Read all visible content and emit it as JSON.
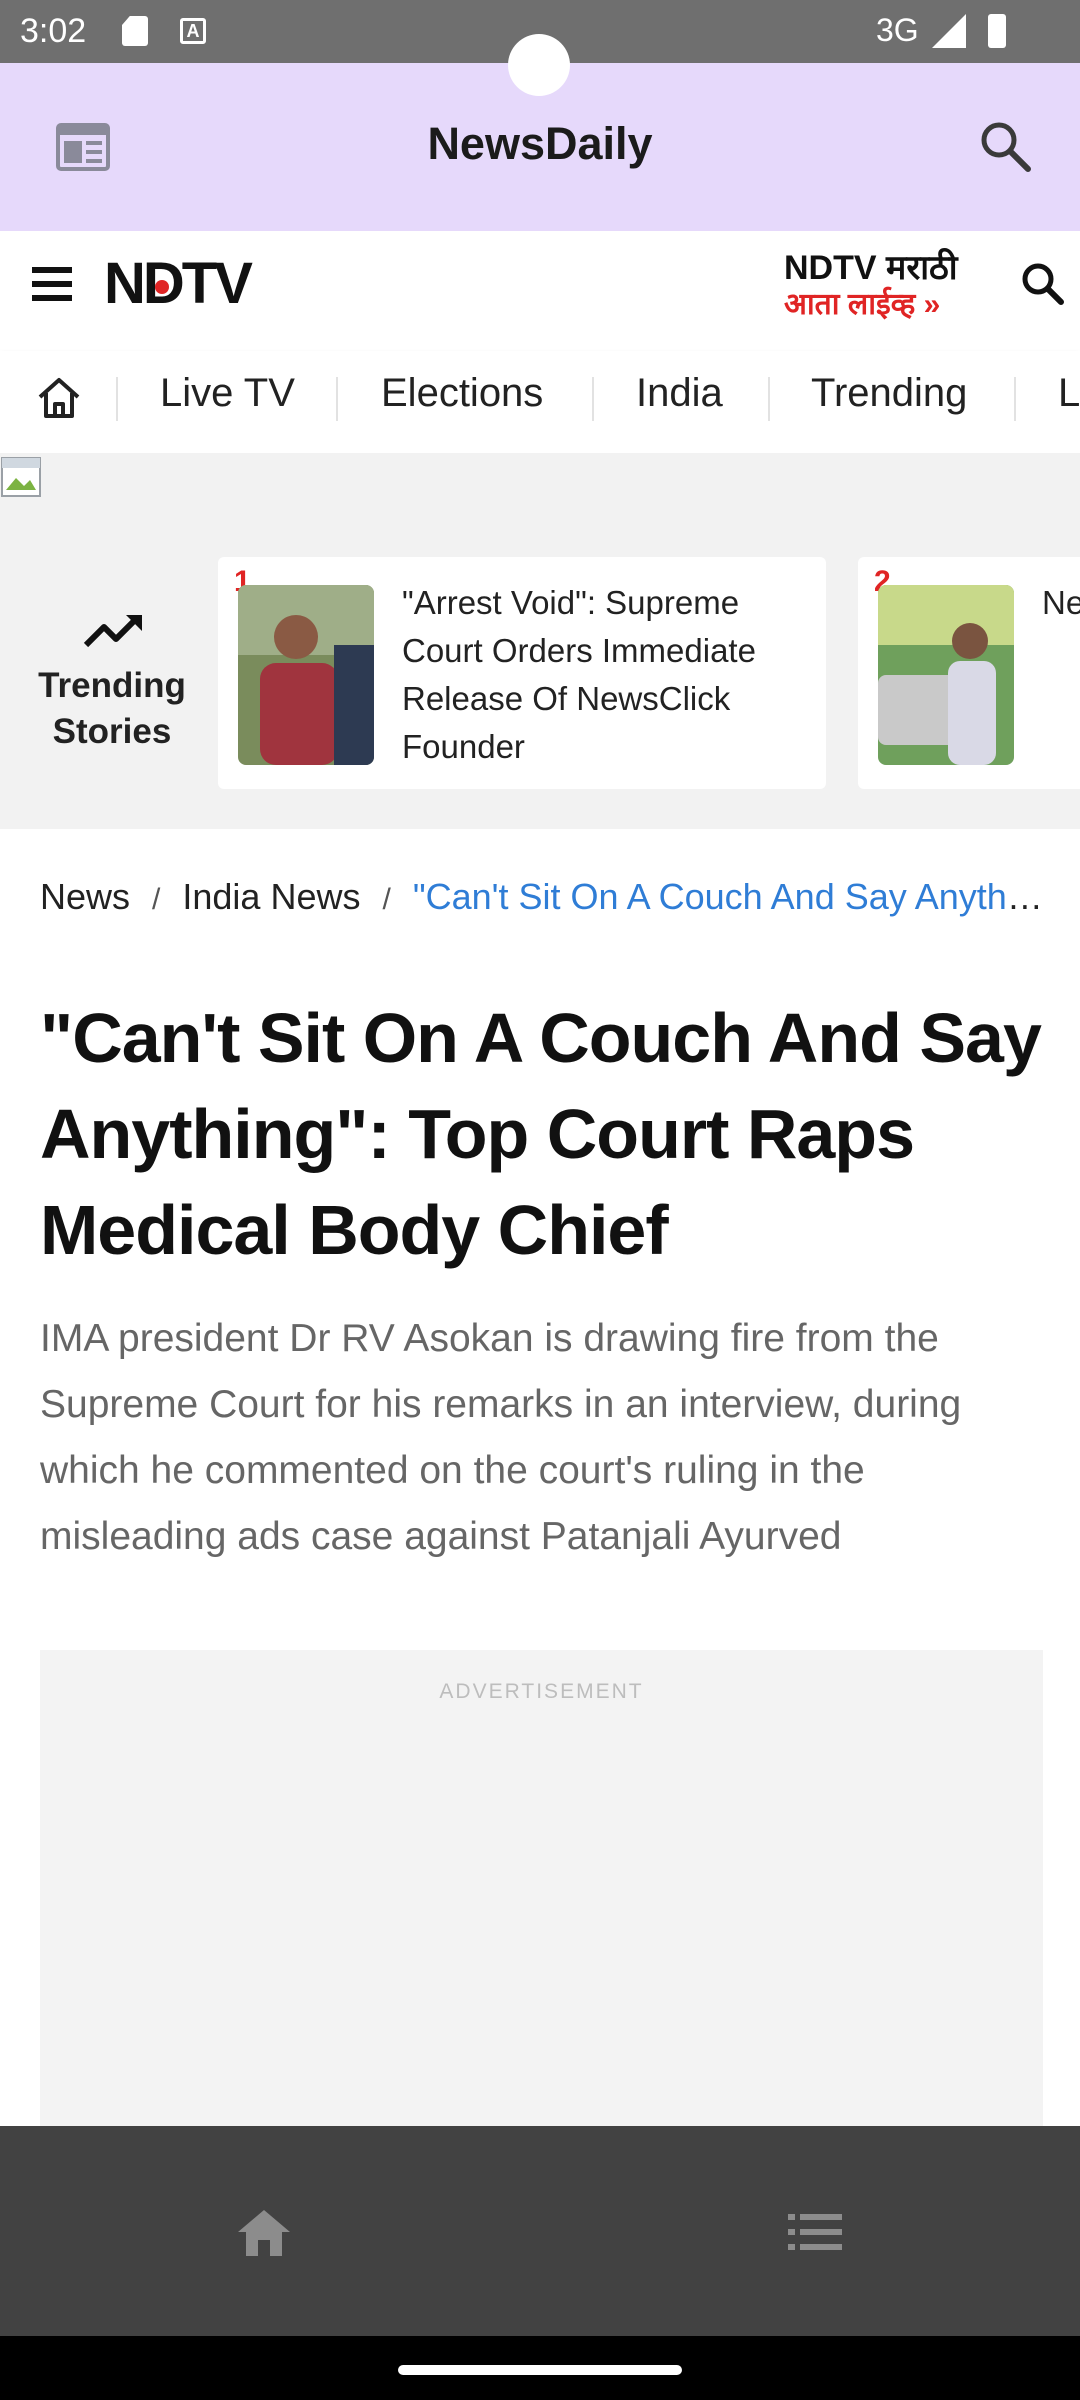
{
  "status_bar": {
    "time": "3:02",
    "network": "3G"
  },
  "app_header": {
    "title": "NewsDaily"
  },
  "ndtv_header": {
    "logo_text": "NDTV",
    "marathi_line1": "NDTV मराठी",
    "marathi_line2": "आता लाईव्ह »"
  },
  "nav": {
    "tabs": [
      {
        "label": "Live TV"
      },
      {
        "label": "Elections"
      },
      {
        "label": "India"
      },
      {
        "label": "Trending"
      },
      {
        "label": "L"
      }
    ]
  },
  "trending": {
    "label": "Trending Stories",
    "cards": [
      {
        "num": "1",
        "text": "\"Arrest Void\": Supreme Court Orders Immediate Release Of NewsClick Founder"
      },
      {
        "num": "2",
        "text": "Ne Ka De Ad"
      }
    ]
  },
  "breadcrumb": {
    "items": [
      "News",
      "India News"
    ],
    "current": "\"Can't Sit On A Couch And Say Anything\": Top Court Raps Medical Body Chief"
  },
  "article": {
    "headline": "\"Can't Sit On A Couch And Say Anything\": Top Court Raps Medical Body Chief",
    "summary": "IMA president Dr RV Asokan is drawing fire from the Supreme Court for his remarks in an interview, during which he commented on the court's ruling in the misleading ads case against Patanjali Ayurved"
  },
  "ad": {
    "label": "ADVERTISEMENT"
  },
  "colors": {
    "app_header_bg": "#e6d9fb",
    "accent_red": "#e02424",
    "link_blue": "#2f7dd6",
    "bottom_nav_bg": "#424242"
  }
}
